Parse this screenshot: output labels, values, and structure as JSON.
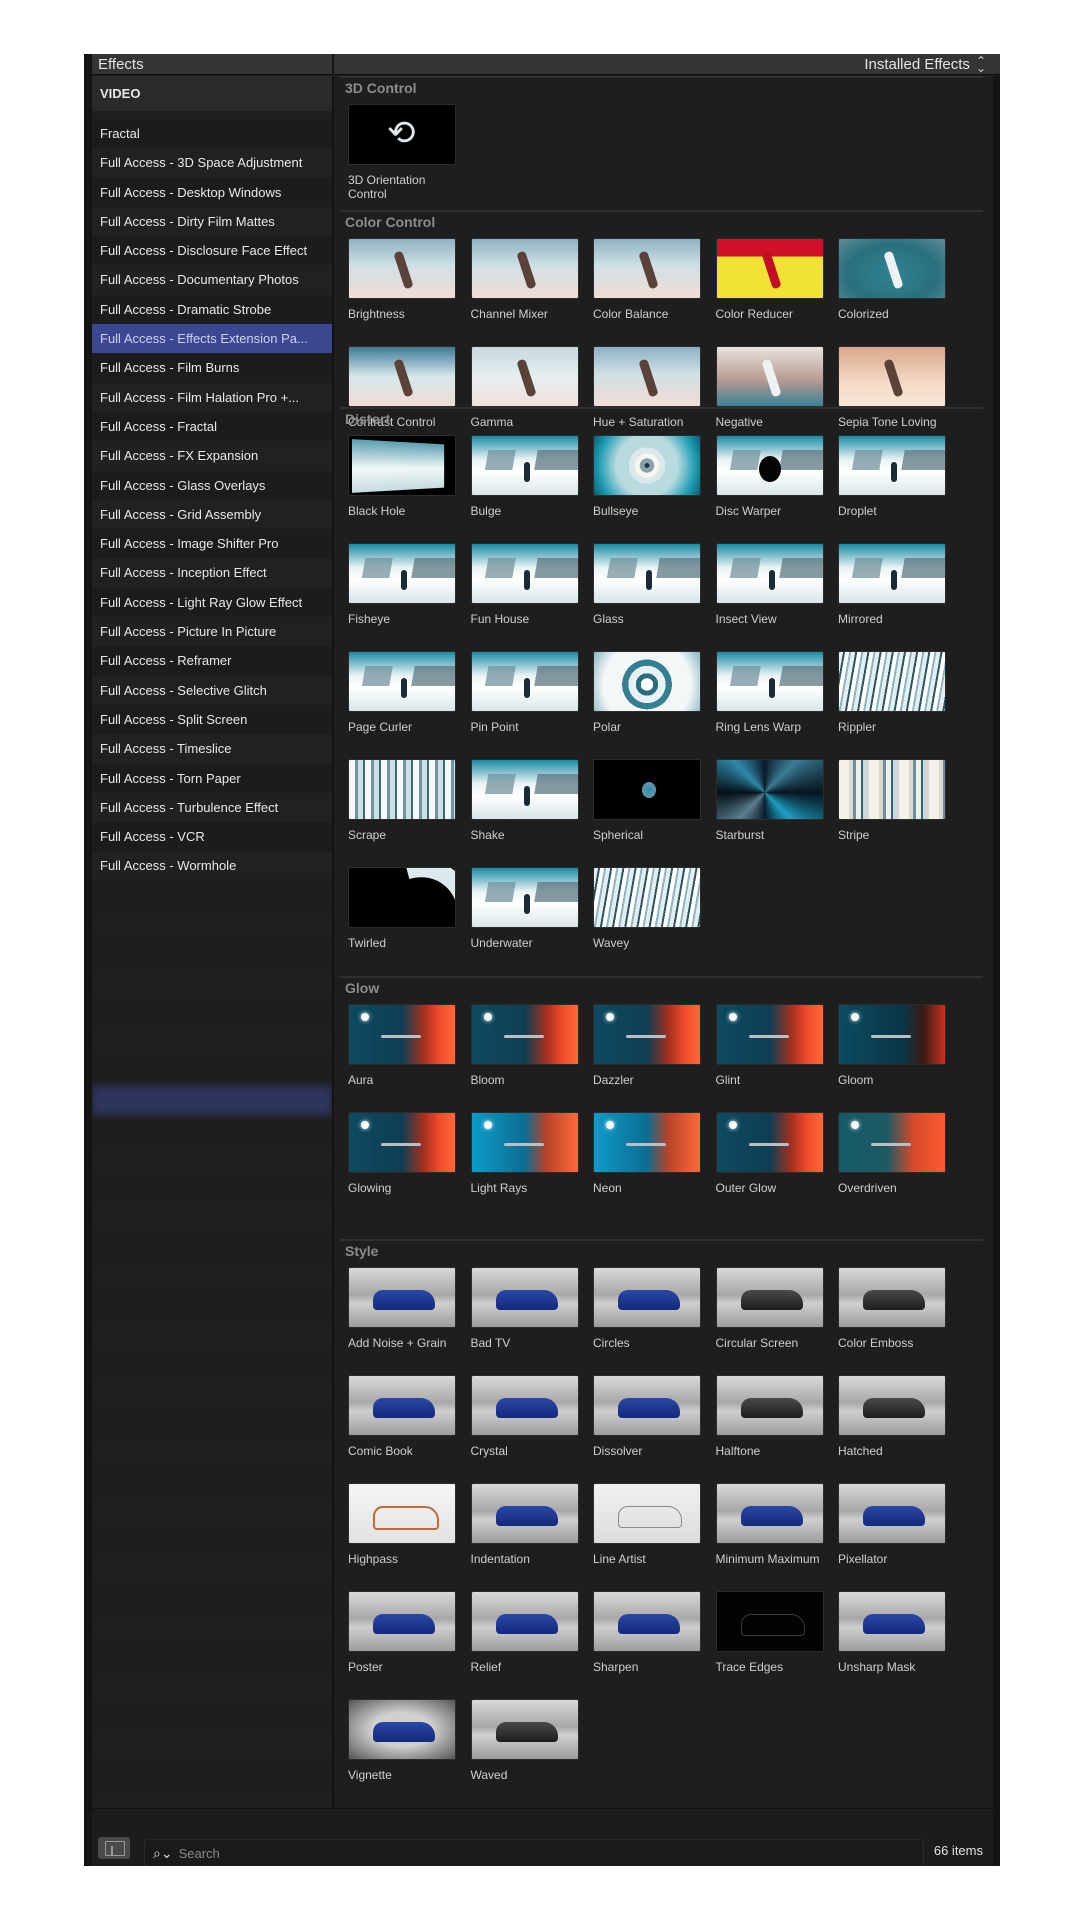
{
  "header": {
    "title": "Effects",
    "filter_label": "Installed Effects",
    "filter_icon": "up-down-chevron-icon"
  },
  "sidebar": {
    "section_header": "VIDEO",
    "items": [
      {
        "label": "Fractal",
        "selected": false
      },
      {
        "label": "Full Access - 3D Space Adjustment",
        "selected": false
      },
      {
        "label": "Full Access - Desktop Windows",
        "selected": false
      },
      {
        "label": "Full Access - Dirty Film Mattes",
        "selected": false
      },
      {
        "label": "Full Access - Disclosure Face Effect",
        "selected": false
      },
      {
        "label": "Full Access - Documentary Photos",
        "selected": false
      },
      {
        "label": "Full Access - Dramatic Strobe",
        "selected": false
      },
      {
        "label": "Full Access - Effects Extension Pa...",
        "selected": true
      },
      {
        "label": "Full Access - Film Burns",
        "selected": false
      },
      {
        "label": "Full Access - Film Halation Pro +...",
        "selected": false
      },
      {
        "label": "Full Access - Fractal",
        "selected": false
      },
      {
        "label": "Full Access - FX Expansion",
        "selected": false
      },
      {
        "label": "Full Access - Glass Overlays",
        "selected": false
      },
      {
        "label": "Full Access - Grid Assembly",
        "selected": false
      },
      {
        "label": "Full Access - Image Shifter Pro",
        "selected": false
      },
      {
        "label": "Full Access - Inception Effect",
        "selected": false
      },
      {
        "label": "Full Access - Light Ray Glow Effect",
        "selected": false
      },
      {
        "label": "Full Access - Picture In Picture",
        "selected": false
      },
      {
        "label": "Full Access - Reframer",
        "selected": false
      },
      {
        "label": "Full Access - Selective Glitch",
        "selected": false
      },
      {
        "label": "Full Access - Split Screen",
        "selected": false
      },
      {
        "label": "Full Access - Timeslice",
        "selected": false
      },
      {
        "label": "Full Access - Torn Paper",
        "selected": false
      },
      {
        "label": "Full Access - Turbulence Effect",
        "selected": false
      },
      {
        "label": "Full Access - VCR",
        "selected": false
      },
      {
        "label": "Full Access - Wormhole",
        "selected": false
      }
    ],
    "selected_color": "#3c4791"
  },
  "sections": [
    {
      "title": "3D Control",
      "items": [
        {
          "label": "3D Orientation Control",
          "thumb": "t-3d"
        }
      ]
    },
    {
      "title": "Color Control",
      "items": [
        {
          "label": "Brightness",
          "thumb": "t-dancer figure"
        },
        {
          "label": "Channel Mixer",
          "thumb": "t-dancer figure"
        },
        {
          "label": "Color Balance",
          "thumb": "t-dancer figure"
        },
        {
          "label": "Color Reducer",
          "thumb": "t-reducer figure fig-red"
        },
        {
          "label": "Colorized",
          "thumb": "t-colorized figure fig-white"
        },
        {
          "label": "Contrast Control",
          "thumb": "t-dancer-hi figure"
        },
        {
          "label": "Gamma",
          "thumb": "t-dancer-pale figure"
        },
        {
          "label": "Hue + Saturation",
          "thumb": "t-dancer figure"
        },
        {
          "label": "Negative",
          "thumb": "t-negative figure fig-white"
        },
        {
          "label": "Sepia Tone Loving",
          "thumb": "t-sepia figure"
        }
      ]
    },
    {
      "title": "Distort",
      "items": [
        {
          "label": "Black Hole",
          "thumb": "t-blackhole"
        },
        {
          "label": "Bulge",
          "thumb": "t-snow t-person"
        },
        {
          "label": "Bullseye",
          "thumb": "t-bullseye"
        },
        {
          "label": "Disc Warper",
          "thumb": "t-snow t-disc"
        },
        {
          "label": "Droplet",
          "thumb": "t-snow t-person"
        },
        {
          "label": "Fisheye",
          "thumb": "t-snow t-person"
        },
        {
          "label": "Fun House",
          "thumb": "t-snow t-person"
        },
        {
          "label": "Glass",
          "thumb": "t-snow t-person"
        },
        {
          "label": "Insect View",
          "thumb": "t-snow t-person"
        },
        {
          "label": "Mirrored",
          "thumb": "t-snow t-person"
        },
        {
          "label": "Page Curler",
          "thumb": "t-snow t-person"
        },
        {
          "label": "Pin Point",
          "thumb": "t-snow t-person"
        },
        {
          "label": "Polar",
          "thumb": "t-polar"
        },
        {
          "label": "Ring Lens Warp",
          "thumb": "t-snow t-person"
        },
        {
          "label": "Rippler",
          "thumb": "t-wavey"
        },
        {
          "label": "Scrape",
          "thumb": "t-scrape"
        },
        {
          "label": "Shake",
          "thumb": "t-snow t-person"
        },
        {
          "label": "Spherical",
          "thumb": "t-spherical"
        },
        {
          "label": "Starburst",
          "thumb": "t-starburst"
        },
        {
          "label": "Stripe",
          "thumb": "t-stripe"
        },
        {
          "label": "Twirled",
          "thumb": "t-twirled"
        },
        {
          "label": "Underwater",
          "thumb": "t-snow t-person"
        },
        {
          "label": "Wavey",
          "thumb": "t-wavey"
        }
      ]
    },
    {
      "title": "Glow",
      "items": [
        {
          "label": "Aura",
          "thumb": "t-glow moon jet"
        },
        {
          "label": "Bloom",
          "thumb": "t-glow moon jet"
        },
        {
          "label": "Dazzler",
          "thumb": "t-glow moon jet"
        },
        {
          "label": "Glint",
          "thumb": "t-glow moon jet"
        },
        {
          "label": "Gloom",
          "thumb": "t-glow-dark moon jet"
        },
        {
          "label": "Glowing",
          "thumb": "t-glow moon jet"
        },
        {
          "label": "Light Rays",
          "thumb": "t-glow-bright moon jet"
        },
        {
          "label": "Neon",
          "thumb": "t-glow-bright moon jet"
        },
        {
          "label": "Outer Glow",
          "thumb": "t-glow moon jet"
        },
        {
          "label": "Overdriven",
          "thumb": "t-glow-over moon jet"
        }
      ]
    },
    {
      "title": "Style",
      "items": [
        {
          "label": "Add Noise + Grain",
          "thumb": "t-car"
        },
        {
          "label": "Bad TV",
          "thumb": "t-car"
        },
        {
          "label": "Circles",
          "thumb": "t-car"
        },
        {
          "label": "Circular Screen",
          "thumb": "t-car t-car-gray"
        },
        {
          "label": "Color Emboss",
          "thumb": "t-car t-car-gray"
        },
        {
          "label": "Comic Book",
          "thumb": "t-car"
        },
        {
          "label": "Crystal",
          "thumb": "t-car"
        },
        {
          "label": "Dissolver",
          "thumb": "t-car"
        },
        {
          "label": "Halftone",
          "thumb": "t-car t-car-gray"
        },
        {
          "label": "Hatched",
          "thumb": "t-car t-car-gray"
        },
        {
          "label": "Highpass",
          "thumb": "t-car-high"
        },
        {
          "label": "Indentation",
          "thumb": "t-car"
        },
        {
          "label": "Line Artist",
          "thumb": "t-car-line"
        },
        {
          "label": "Minimum Maximum",
          "thumb": "t-car"
        },
        {
          "label": "Pixellator",
          "thumb": "t-car"
        },
        {
          "label": "Poster",
          "thumb": "t-car"
        },
        {
          "label": "Relief",
          "thumb": "t-car"
        },
        {
          "label": "Sharpen",
          "thumb": "t-car"
        },
        {
          "label": "Trace Edges",
          "thumb": "t-trace"
        },
        {
          "label": "Unsharp Mask",
          "thumb": "t-car"
        },
        {
          "label": "Vignette",
          "thumb": "t-vignette t-car"
        },
        {
          "label": "Waved",
          "thumb": "t-car t-car-gray"
        }
      ]
    }
  ],
  "footer": {
    "layout_button_icon": "sidebar-layout-icon",
    "search_icon": "search-icon",
    "search_placeholder": "Search",
    "search_value": "",
    "item_count": "66 items"
  }
}
